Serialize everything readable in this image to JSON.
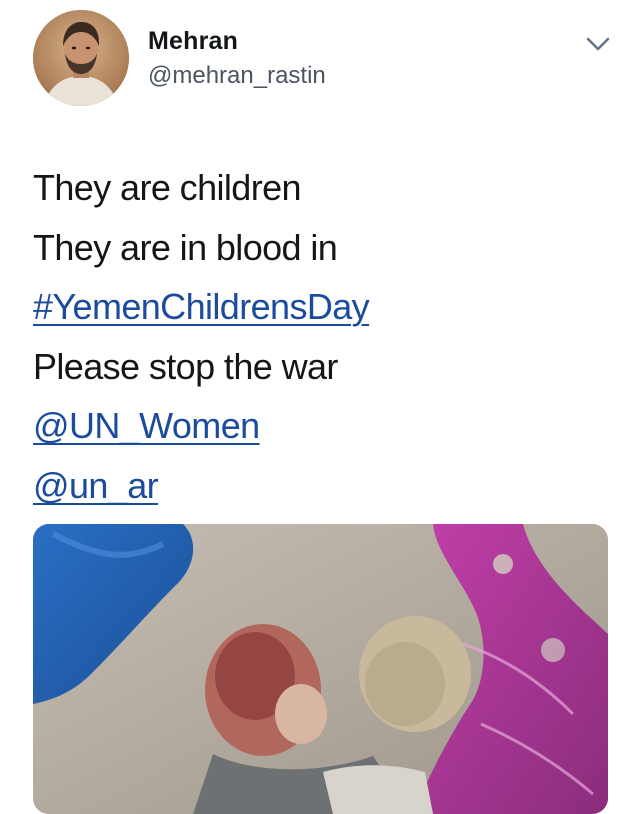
{
  "author": {
    "display_name": "Mehran",
    "handle": "@mehran_rastin",
    "avatar_icon": "profile-avatar"
  },
  "header_menu": {
    "icon": "chevron-down-icon"
  },
  "tweet": {
    "lines": [
      {
        "text": "They are children",
        "type": "text"
      },
      {
        "text": "They are in blood in",
        "type": "text"
      },
      {
        "text": "#YemenChildrensDay",
        "type": "hashtag"
      },
      {
        "text": "Please stop the war",
        "type": "text"
      },
      {
        "text": "@UN_Women",
        "type": "mention"
      },
      {
        "text": "@un_ar",
        "type": "mention"
      }
    ]
  },
  "media": {
    "icon": "photo-attachment"
  },
  "colors": {
    "link": "#1b4b9c",
    "text": "#14171a",
    "secondary_text": "#4b5560"
  }
}
